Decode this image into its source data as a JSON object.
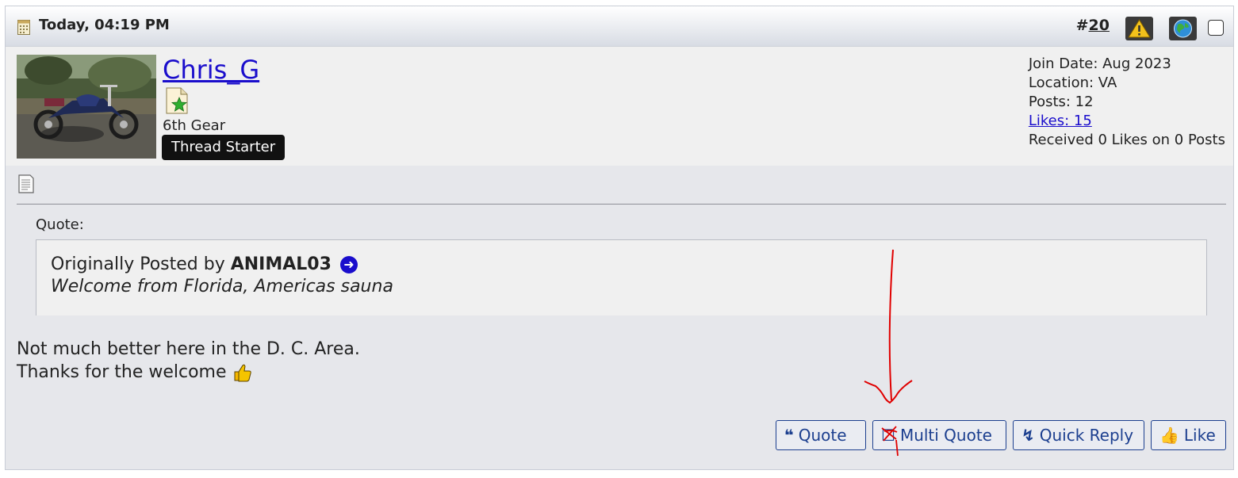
{
  "post": {
    "date": "Today, 04:19 PM",
    "number_prefix": "#",
    "number": "20"
  },
  "user": {
    "name": "Chris_G",
    "title": "6th Gear",
    "badge": "Thread Starter",
    "join_date": "Join Date: Aug 2023",
    "location": "Location: VA",
    "posts": "Posts: 12",
    "likes": "Likes: 15",
    "received": "Received 0 Likes on 0 Posts"
  },
  "quote": {
    "label": "Quote:",
    "by_prefix": "Originally Posted by",
    "author": "ANIMAL03",
    "text": "Welcome from Florida, Americas sauna"
  },
  "message": {
    "line1": "Not much better here in the D. C. Area.",
    "line2": "Thanks for the welcome"
  },
  "buttons": {
    "quote": "Quote",
    "multi_quote": "Multi Quote",
    "quick_reply": "Quick Reply",
    "like": "Like"
  },
  "icons": [
    "calendar-icon",
    "report-icon",
    "ip-icon",
    "rank-icon",
    "message-icon",
    "goto-post-icon",
    "thumbs-up-emoji",
    "quote-icon",
    "multiquote-icon",
    "bolt-icon",
    "like-icon"
  ],
  "colors": {
    "link": "#1a0dcc",
    "button_text": "#1c3f8f",
    "annotation": "#e00000"
  }
}
